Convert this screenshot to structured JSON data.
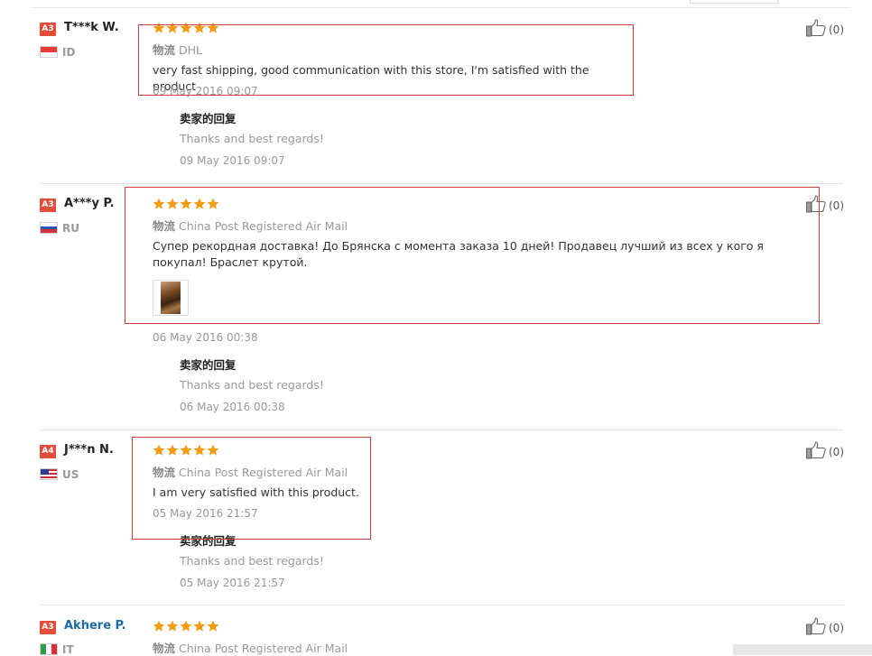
{
  "reviews": [
    {
      "level": "A3",
      "name": "T***k W.",
      "country": "ID",
      "rating": 5,
      "shipping_label": "物流",
      "shipping": "DHL",
      "comment": "very fast shipping, good communication with this store, I'm satisfied with the product",
      "date": "09 May 2016 09:07",
      "reply_title": "卖家的回复",
      "reply_text": "Thanks and best regards!",
      "reply_date": "09 May 2016 09:07",
      "helpful": "(0)"
    },
    {
      "level": "A3",
      "name": "A***y P.",
      "country": "RU",
      "rating": 5,
      "shipping_label": "物流",
      "shipping": "China Post Registered Air Mail",
      "comment": "Супер рекордная доставка! До Брянска с момента заказа 10 дней! Продавец лучший из всех у кого я покупал! Браслет крутой.",
      "has_photo": true,
      "date": "06 May 2016 00:38",
      "reply_title": "卖家的回复",
      "reply_text": "Thanks and best regards!",
      "reply_date": "06 May 2016 00:38",
      "helpful": "(0)"
    },
    {
      "level": "A4",
      "name": "J***n N.",
      "country": "US",
      "rating": 5,
      "shipping_label": "物流",
      "shipping": "China Post Registered Air Mail",
      "comment": "I am very satisfied with this product.",
      "date": "05 May 2016 21:57",
      "reply_title": "卖家的回复",
      "reply_text": "Thanks and best regards!",
      "reply_date": "05 May 2016 21:57",
      "helpful": "(0)"
    },
    {
      "level": "A3",
      "name": "Akhere P.",
      "country": "IT",
      "rating": 5,
      "shipping_label": "物流",
      "shipping": "China Post Registered Air Mail",
      "helpful": "(0)"
    }
  ],
  "colors": {
    "star": "#f39c12",
    "highlight": "#d63b3b",
    "badge": "#e24e3a",
    "link": "#1d6aa5"
  },
  "icons": {
    "star": "star-icon",
    "helpful": "thumbs-up-icon",
    "flags": [
      "flag-id-icon",
      "flag-ru-icon",
      "flag-us-icon",
      "flag-it-icon"
    ]
  }
}
